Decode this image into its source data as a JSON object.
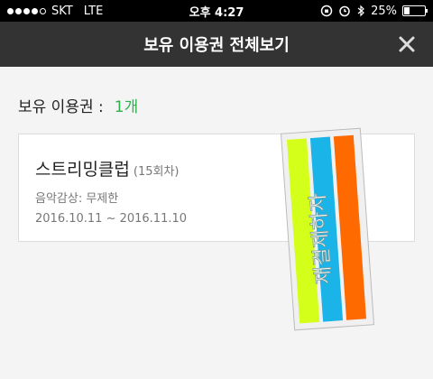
{
  "status_bar": {
    "carrier": "SKT",
    "network": "LTE",
    "time": "오후 4:27",
    "battery": "25%",
    "battery_level": 0.25,
    "icons": [
      "signal-dots-icon",
      "orientation-lock-icon",
      "alarm-icon",
      "bluetooth-icon",
      "battery-icon"
    ]
  },
  "header": {
    "title": "보유 이용권 전체보기",
    "close_icon": "close-icon"
  },
  "summary": {
    "label": "보유 이용권 :",
    "count": "1개",
    "count_color": "#2bb24c"
  },
  "ticket": {
    "name": "스트리밍클럽",
    "sub": "(15회차)",
    "description": "음악감상: 무제한",
    "period": "2016.10.11 ~ 2016.11.10"
  },
  "stamp": {
    "text": "재결제하자",
    "stripe_colors": [
      "#d4ff1a",
      "#1ab4e8",
      "#ff6a00"
    ],
    "frame_color": "#c0c0c0"
  }
}
